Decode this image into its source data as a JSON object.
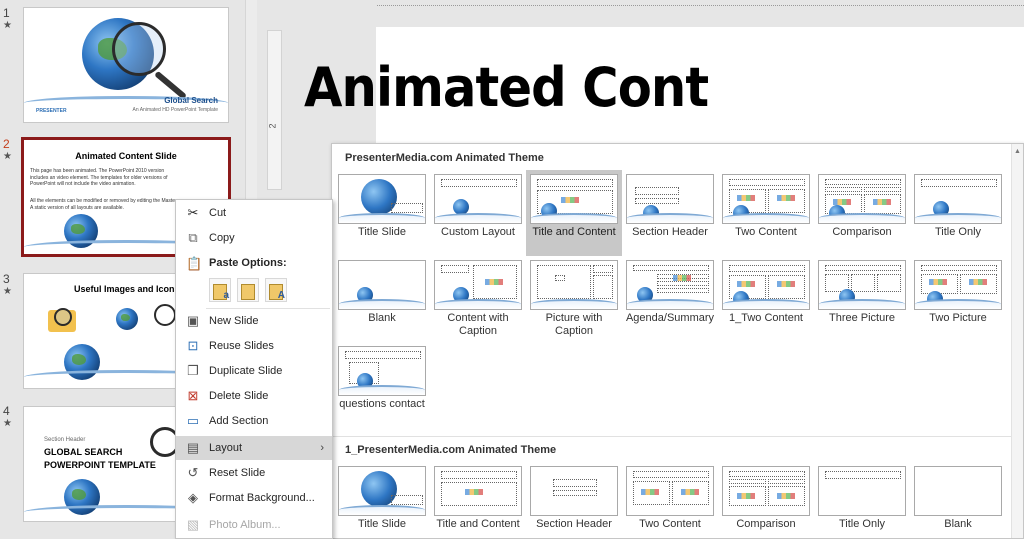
{
  "thumbnails": [
    {
      "number": "1",
      "title": "Global Search",
      "subtitle": "An Animated HD PowerPoint Template",
      "logo_text": "PRESENTER"
    },
    {
      "number": "2",
      "title": "Animated Content Slide",
      "body": "This page has been animated.  The PowerPoint 2010 version includes an video element.  The templates for older versions of PowerPoint will not include the video animation.",
      "body2": "All the elements can be modified or removed by editing the Master.  A static version of all layouts are available."
    },
    {
      "number": "3",
      "title": "Useful Images and Icons"
    },
    {
      "number": "4",
      "label": "Section Header",
      "title_line1": "GLOBAL SEARCH",
      "title_line2": "POWERPOINT TEMPLATE"
    }
  ],
  "ruler": {
    "mark": "2"
  },
  "slide": {
    "title": "Animated Cont"
  },
  "context_menu": {
    "cut": "Cut",
    "copy": "Copy",
    "paste_options": "Paste Options:",
    "paste_buttons": [
      "a",
      "",
      "A"
    ],
    "new_slide": "New Slide",
    "reuse_slides": "Reuse Slides",
    "duplicate_slide": "Duplicate Slide",
    "delete_slide": "Delete Slide",
    "add_section": "Add Section",
    "layout": "Layout",
    "reset_slide": "Reset Slide",
    "format_background": "Format Background...",
    "photo_album": "Photo Album..."
  },
  "gallery": {
    "section1_title": "PresenterMedia.com Animated Theme",
    "section1_layouts": [
      "Title Slide",
      "Custom Layout",
      "Title and Content",
      "Section Header",
      "Two Content",
      "Comparison",
      "Title Only",
      "Blank",
      "Content with Caption",
      "Picture with Caption",
      "Agenda/Summary",
      "1_Two Content",
      "Three Picture",
      "Two Picture",
      "questions contact"
    ],
    "selected_layout": "Title and Content",
    "section2_title": "1_PresenterMedia.com Animated Theme",
    "section2_layouts": [
      "Title Slide",
      "Title and Content",
      "Section Header",
      "Two Content",
      "Comparison",
      "Title Only",
      "Blank"
    ]
  }
}
